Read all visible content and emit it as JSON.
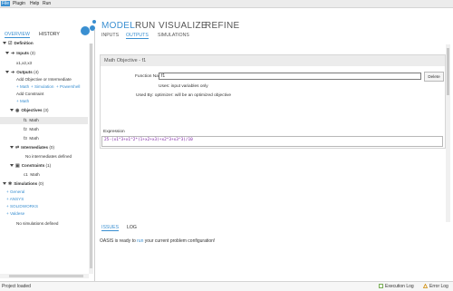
{
  "menu": {
    "items": [
      "File",
      "Plugin",
      "Help",
      "Run"
    ]
  },
  "nav": {
    "model": "MODEL",
    "run": "RUN",
    "visualize": "VISUALIZE",
    "refine": "REFINE"
  },
  "subnav": {
    "inputs": "INPUTS",
    "outputs": "OUTPUTS",
    "simulations": "SIMULATIONS"
  },
  "sidebar": {
    "tabs": {
      "overview": "OVERVIEW",
      "history": "HISTORY"
    },
    "definition": "Definition",
    "inputs_label": "Inputs",
    "inputs_count": "(3)",
    "inputs_vars": "x1,x2,x3",
    "outputs_label": "Outputs",
    "outputs_count": "(4)",
    "add_objective": "Add Objective or Intermediate",
    "add_math": "+ Math",
    "add_simulation": "+ Simulation",
    "add_powershell": "+ Powershell",
    "add_constraint": "Add Constraint",
    "add_constraint_math": "+ Math",
    "objectives_label": "Objectives",
    "objectives_count": "(3)",
    "objectives": [
      {
        "id": "f1",
        "type": "Math"
      },
      {
        "id": "f2",
        "type": "Math"
      },
      {
        "id": "f3",
        "type": "Math"
      }
    ],
    "intermediates_label": "Intermediates",
    "intermediates_count": "(0)",
    "no_intermediates": "No intermediates defined",
    "constraints_label": "Constraints",
    "constraints_count": "(1)",
    "constraint": {
      "id": "c1",
      "type": "Math"
    },
    "simulations_label": "Simulations",
    "simulations_count": "(0)",
    "sim_links": [
      "+ General",
      "+ ANSYS",
      "+ SOLIDWORKS",
      "+ Valdese"
    ],
    "no_simulations": "No simulations defined"
  },
  "panel": {
    "title": "Math Objective - f1",
    "function_name_label": "Function Name",
    "function_name_value": "f1",
    "delete_label": "Delete",
    "uses_text": "Uses: input variables only",
    "used_by_text": "Used By: optimizer: will be an optimized objective",
    "expression_label": "Expression",
    "expression_value": "25-(x1^3+x1^2*(1+x2+x3)+x2^3+x3^3)/10"
  },
  "bottom": {
    "tabs": {
      "issues": "ISSUES",
      "log": "LOG"
    },
    "message_pre": "OASIS is ready to",
    "message_link": "run",
    "message_post": "your current problem configuration!"
  },
  "status": {
    "text": "Project loaded",
    "execution_log": "Execution Log",
    "error_log": "Error Log"
  },
  "colors": {
    "accent": "#3a8fd1",
    "expression": "#7a1fa2"
  }
}
